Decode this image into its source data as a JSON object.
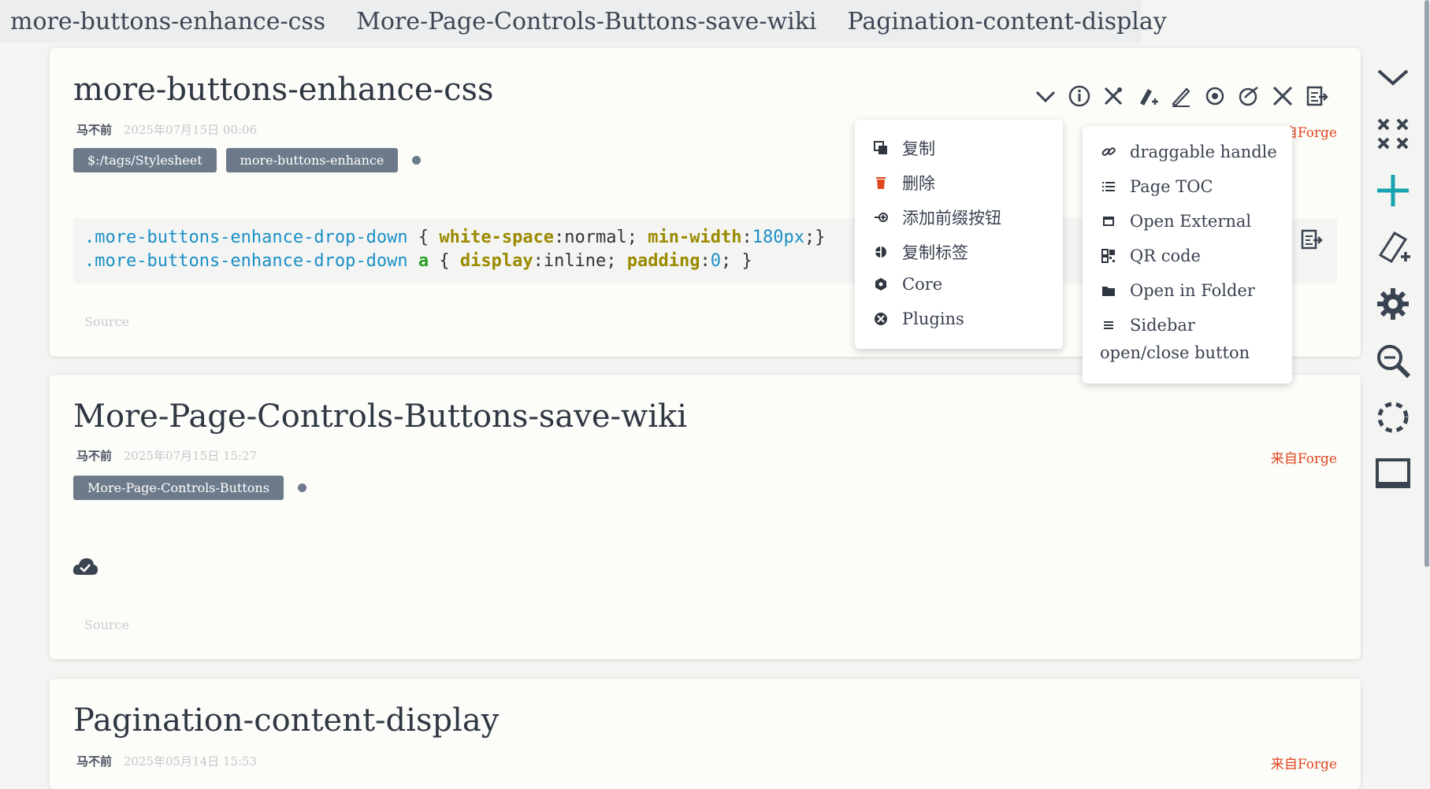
{
  "tabs": [
    "more-buttons-enhance-css",
    "More-Page-Controls-Buttons-save-wiki",
    "Pagination-content-display"
  ],
  "tiddler1": {
    "title": "more-buttons-enhance-css",
    "author": "马不前",
    "date": "2025年07月15日 00:06",
    "from": "来自Forge",
    "tags": [
      "$:/tags/Stylesheet",
      "more-buttons-enhance"
    ],
    "code": {
      "line1": {
        "selector": ".more-buttons-enhance-drop-down",
        "open": " { ",
        "prop1": "white-space",
        "val1": ":normal; ",
        "prop2": "min-width",
        "colon": ":",
        "num": "180px",
        "close": ";}"
      },
      "line2": {
        "selector": ".more-buttons-enhance-drop-down",
        "sp": " ",
        "kw": "a",
        "open": " { ",
        "prop1": "display",
        "val1": ":inline; ",
        "prop2": "padding",
        "colon": ":",
        "num": "0",
        "close": "; }"
      }
    },
    "source": "Source"
  },
  "tiddler2": {
    "title": "More-Page-Controls-Buttons-save-wiki",
    "author": "马不前",
    "date": "2025年07月15日 15:27",
    "from": "来自Forge",
    "tags": [
      "More-Page-Controls-Buttons"
    ],
    "source": "Source"
  },
  "tiddler3": {
    "title": "Pagination-content-display",
    "author": "马不前",
    "date": "2025年05月14日 15:53",
    "from": "来自Forge"
  },
  "dropdown_left": [
    {
      "label": "复制",
      "icon": "clone-icon"
    },
    {
      "label": "删除",
      "icon": "trash-icon"
    },
    {
      "label": "添加前缀按钮",
      "icon": "prefix-icon"
    },
    {
      "label": "复制标签",
      "icon": "copy-tag-icon"
    },
    {
      "label": "Core",
      "icon": "core-icon"
    },
    {
      "label": "Plugins",
      "icon": "plugins-icon"
    }
  ],
  "dropdown_right": [
    {
      "label": "draggable handle",
      "icon": "link-icon"
    },
    {
      "label": "Page TOC",
      "icon": "list-icon"
    },
    {
      "label": "Open External",
      "icon": "window-icon"
    },
    {
      "label": "QR code",
      "icon": "qr-icon"
    },
    {
      "label": "Open in Folder",
      "icon": "folder-icon"
    },
    {
      "label": "Sidebar",
      "icon": "menu-icon"
    }
  ],
  "dropdown_right_wrap": "open/close button",
  "colors": {
    "accent": "#19a2b0",
    "tag": "#6d7a8a",
    "from": "#e0461f"
  }
}
